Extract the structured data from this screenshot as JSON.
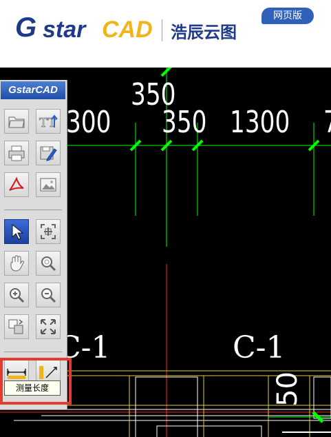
{
  "header": {
    "logo_g": "G",
    "logo_star": "star",
    "logo_cad": "CAD",
    "logo_cn": "浩辰云图",
    "badge": "网页版"
  },
  "canvas": {
    "dims": [
      "350",
      "300",
      "350",
      "1300",
      "7"
    ],
    "labels": [
      "C-1",
      "C-1"
    ],
    "rotated": "50"
  },
  "toolbar": {
    "logo": "GstarCAD",
    "tooltip": "测量长度"
  },
  "colors": {
    "brand_blue": "#1f3a8a",
    "brand_yellow": "#f0b51b",
    "canvas_bg": "#000000",
    "cad_green": "#00ff00",
    "cad_red": "#ff2020",
    "highlight": "#e23b30"
  }
}
